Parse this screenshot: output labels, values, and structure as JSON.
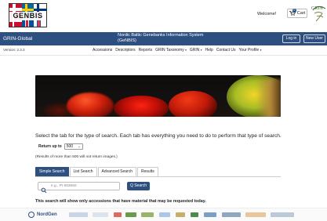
{
  "header": {
    "logo_text": "GENBIS",
    "welcome": "Welcome!",
    "cart_label": "Cart",
    "cart_count": "0",
    "grin_logo_text": "GRIN"
  },
  "navbar": {
    "brand": "GRIN-Global",
    "title_line1": "Nordic Baltic Genebanks Information System",
    "title_line2": "(GeNBIS)",
    "login": "Log in",
    "new_user": "New User"
  },
  "menu": {
    "version": "Version: 2.3.3",
    "items": [
      {
        "label": "Accessions",
        "dropdown": false
      },
      {
        "label": "Descriptors",
        "dropdown": false
      },
      {
        "label": "Reports",
        "dropdown": false
      },
      {
        "label": "GRIN Taxonomy",
        "dropdown": true
      },
      {
        "label": "GRIN",
        "dropdown": true
      },
      {
        "label": "Help",
        "dropdown": false
      },
      {
        "label": "Contact Us",
        "dropdown": false
      },
      {
        "label": "Your Profile",
        "dropdown": true
      }
    ]
  },
  "content": {
    "headline": "Select the tab for the type of search. Each tab has everything you need to do to perform that type of search.",
    "return_label": "Return up to",
    "return_value": "500",
    "note": "(Results of more than 500 will not return images.)",
    "tabs": [
      {
        "label": "Simple Search",
        "active": true
      },
      {
        "label": "List Search",
        "active": false
      },
      {
        "label": "Advanced Search",
        "active": false
      },
      {
        "label": "Results",
        "active": false
      }
    ],
    "search_placeholder": "e.g., PI 653650",
    "search_button": "Q Search",
    "notice": "This search will show only accessions that have material that may be requested today."
  },
  "footer": {
    "partner_logo": "NordGen"
  },
  "colors": {
    "primary": "#2e5080",
    "text": "#222222"
  }
}
